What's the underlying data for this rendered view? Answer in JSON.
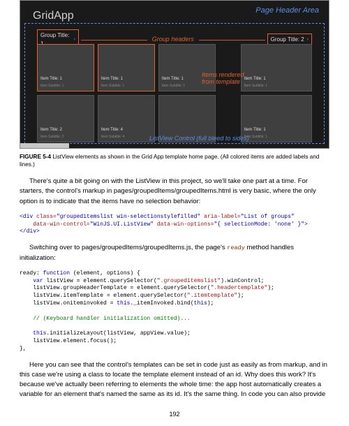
{
  "figure": {
    "page_header_area": "Page  Header  Area",
    "app_title": "GridApp",
    "group_headers_label": "Group headers",
    "group1_header": "Group Title: 1",
    "group2_header": "Group Title: 2",
    "items_rendered_annot": "Items rendered from template",
    "listview_annot": "ListView Control (full bleed to sides)",
    "tiles_g1": [
      {
        "title": "Item Title: 1",
        "sub": "Item Subtitle: 1"
      },
      {
        "title": "Item Title: 1",
        "sub": "Item Subtitle: 1"
      },
      {
        "title": "Item Title: 1",
        "sub": "Item Subtitle: 1"
      },
      {
        "title": "Item Title: 2",
        "sub": "Item Subtitle: 2"
      },
      {
        "title": "Item Title: 4",
        "sub": "Item Subtitle: 4"
      },
      {
        "title": "",
        "sub": ""
      }
    ],
    "tiles_g2": [
      {
        "title": "Item Title: 1",
        "sub": "Item Subtitle: 1"
      },
      {
        "title": "Item Title: 1",
        "sub": "Item Subtitle: 1"
      }
    ]
  },
  "caption": {
    "label": "FIGURE 5-4",
    "text": " ListView elements as shown in the Grid App template home page. (All colored items are added labels and lines.)"
  },
  "para1": "There's quite a bit going on with the ListView in this project, so we'll take one part at a time. For starters, the control's markup in pages/groupedItems/groupedItems.html is very basic, where the only option is to indicate that the items have no selection behavior:",
  "code1": {
    "t1": "<div",
    "t2": " class=",
    "t3": "\"groupeditemslist win-selectionstylefilled\"",
    "t4": " aria-label=",
    "t5": "\"List of groups\"",
    "t6": "    data-win-control=",
    "t7": "\"WinJS.UI.ListView\"",
    "t8": " data-win-options=",
    "t9": "\"{ selectionMode: 'none' }\">",
    "t10": "</div>"
  },
  "para2_a": "Switching over to pages/groupedItems/groupedItems.js, the page's ",
  "para2_ready": "ready",
  "para2_b": " method handles initialization:",
  "code2": {
    "l1_a": "ready: ",
    "l1_b": "function",
    "l1_c": " (element, options) {",
    "l2_a": "    var",
    "l2_b": " listView = element.querySelector(",
    "l2_c": "\".groupeditemslist\"",
    "l2_d": ").winControl;",
    "l3_a": "    listView.groupHeaderTemplate = element.querySelector(",
    "l3_b": "\".headertemplate\"",
    "l3_c": ");",
    "l4_a": "    listView.itemTemplate = element.querySelector(",
    "l4_b": "\".itemtemplate\"",
    "l4_c": ");",
    "l5_a": "    listView.oniteminvoked = ",
    "l5_b": "this",
    "l5_c": "._itemInvoked.bind(",
    "l5_d": "this",
    "l5_e": ");",
    "l6": "    // (Keyboard handler initialization omitted)...",
    "l7_a": "    this",
    "l7_b": ".initializeLayout(listView, appView.value);",
    "l8": "    listView.element.focus();",
    "l9": "},"
  },
  "para3": "Here you can see that the control's templates can be set in code just as easily as from markup, and in this case we're using a class to locate the template element instead of an id. Why does this work? It's because we've actually been referring to elements the whole time: the app host automatically creates a variable for an element that's named the same as its id. It's the same thing. In code you can also provide",
  "page_number": "192"
}
